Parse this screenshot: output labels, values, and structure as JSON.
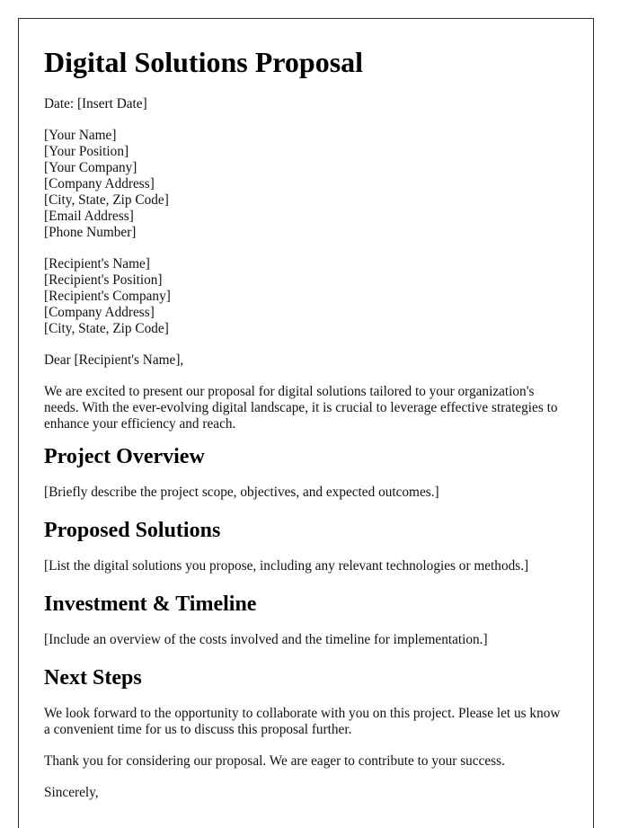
{
  "title": "Digital Solutions Proposal",
  "date_line": "Date: [Insert Date]",
  "sender": [
    "[Your Name]",
    "[Your Position]",
    "[Your Company]",
    "[Company Address]",
    "[City, State, Zip Code]",
    "[Email Address]",
    "[Phone Number]"
  ],
  "recipient": [
    "[Recipient's Name]",
    "[Recipient's Position]",
    "[Recipient's Company]",
    "[Company Address]",
    "[City, State, Zip Code]"
  ],
  "salutation": "Dear [Recipient's Name],",
  "intro": "We are excited to present our proposal for digital solutions tailored to your organization's needs. With the ever-evolving digital landscape, it is crucial to leverage effective strategies to enhance your efficiency and reach.",
  "sections": [
    {
      "heading": "Project Overview",
      "body": "[Briefly describe the project scope, objectives, and expected outcomes.]"
    },
    {
      "heading": "Proposed Solutions",
      "body": "[List the digital solutions you propose, including any relevant technologies or methods.]"
    },
    {
      "heading": "Investment & Timeline",
      "body": "[Include an overview of the costs involved and the timeline for implementation.]"
    },
    {
      "heading": "Next Steps",
      "body": "We look forward to the opportunity to collaborate with you on this project. Please let us know a convenient time for us to discuss this proposal further."
    }
  ],
  "thanks": "Thank you for considering our proposal. We are eager to contribute to your success.",
  "closing": "Sincerely,"
}
